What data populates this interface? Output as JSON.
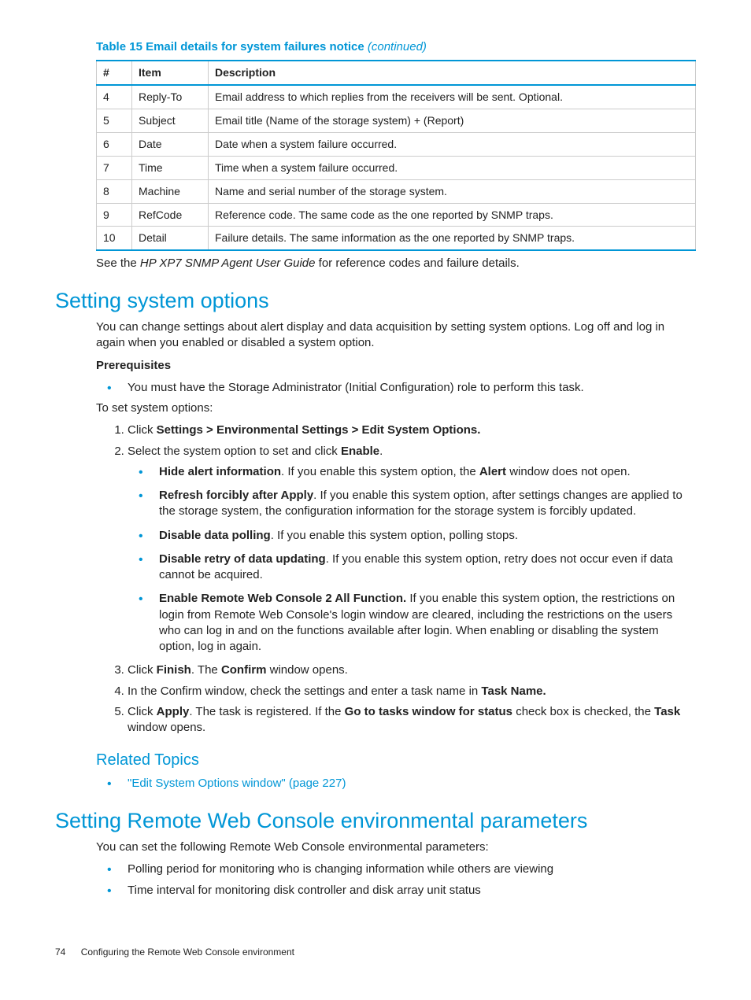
{
  "table": {
    "title_prefix": "Table 15 Email details for system failures notice ",
    "title_suffix": "(continued)",
    "headers": {
      "h1": "#",
      "h2": "Item",
      "h3": "Description"
    },
    "rows": [
      {
        "n": "4",
        "item": "Reply-To",
        "desc": "Email address to which replies from the receivers will be sent. Optional."
      },
      {
        "n": "5",
        "item": "Subject",
        "desc": "Email title (Name of the storage system) + (Report)"
      },
      {
        "n": "6",
        "item": "Date",
        "desc": "Date when a system failure occurred."
      },
      {
        "n": "7",
        "item": "Time",
        "desc": "Time when a system failure occurred."
      },
      {
        "n": "8",
        "item": "Machine",
        "desc": "Name and serial number of the storage system."
      },
      {
        "n": "9",
        "item": "RefCode",
        "desc": "Reference code. The same code as the one reported by SNMP traps."
      },
      {
        "n": "10",
        "item": "Detail",
        "desc": "Failure details. The same information as the one reported by SNMP traps."
      }
    ]
  },
  "caption": {
    "pre": "See the ",
    "it": "HP XP7 SNMP Agent User Guide",
    "post": " for reference codes and failure details."
  },
  "h1a": "Setting system options",
  "intro": "You can change settings about alert display and data acquisition by setting system options. Log off and log in again when you enabled or disabled a system option.",
  "prereq_label": "Prerequisites",
  "prereq_item": "You must have the Storage Administrator (Initial Configuration) role to perform this task.",
  "to_set": "To set system options:",
  "step1": {
    "a": "Click ",
    "b": "Settings > Environmental Settings > Edit System Options."
  },
  "step2": {
    "a": "Select the system option to set and click ",
    "b": "Enable",
    "c": "."
  },
  "opt1": {
    "b": "Hide alert information",
    "t1": ". If you enable this system option, the ",
    "b2": "Alert",
    "t2": " window does not open."
  },
  "opt2": {
    "b": "Refresh forcibly after Apply",
    "t": ". If you enable this system option, after settings changes are applied to the storage system, the configuration information for the storage system is forcibly updated."
  },
  "opt3": {
    "b": "Disable data polling",
    "t": ". If you enable this system option, polling stops."
  },
  "opt4": {
    "b": "Disable retry of data updating",
    "t": ". If you enable this system option, retry does not occur even if data cannot be acquired."
  },
  "opt5": {
    "b": "Enable Remote Web Console 2 All Function.",
    "t": " If you enable this system option, the restrictions on login from Remote Web Console's login window are cleared, including the restrictions on the users who can log in and on the functions available after login. When enabling or disabling the system option, log in again."
  },
  "step3": {
    "a": "Click ",
    "b": "Finish",
    "c": ". The ",
    "d": "Confirm",
    "e": " window opens."
  },
  "step4": {
    "a": "In the Confirm window, check the settings and enter a task name in ",
    "b": "Task Name."
  },
  "step5": {
    "a": "Click ",
    "b": "Apply",
    "c": ". The task is registered. If the ",
    "d": "Go to tasks window for status",
    "e": " check box is checked, the ",
    "f": "Task",
    "g": " window opens."
  },
  "related_h": "Related Topics",
  "related_link": "\"Edit System Options window\" (page 227)",
  "h1b": "Setting Remote Web Console environmental parameters",
  "env_intro": "You can set the following Remote Web Console environmental parameters:",
  "env1": "Polling period for monitoring who is changing information while others are viewing",
  "env2": "Time interval for monitoring disk controller and disk array unit status",
  "footer": {
    "page": "74",
    "title": "Configuring the Remote Web Console environment"
  }
}
